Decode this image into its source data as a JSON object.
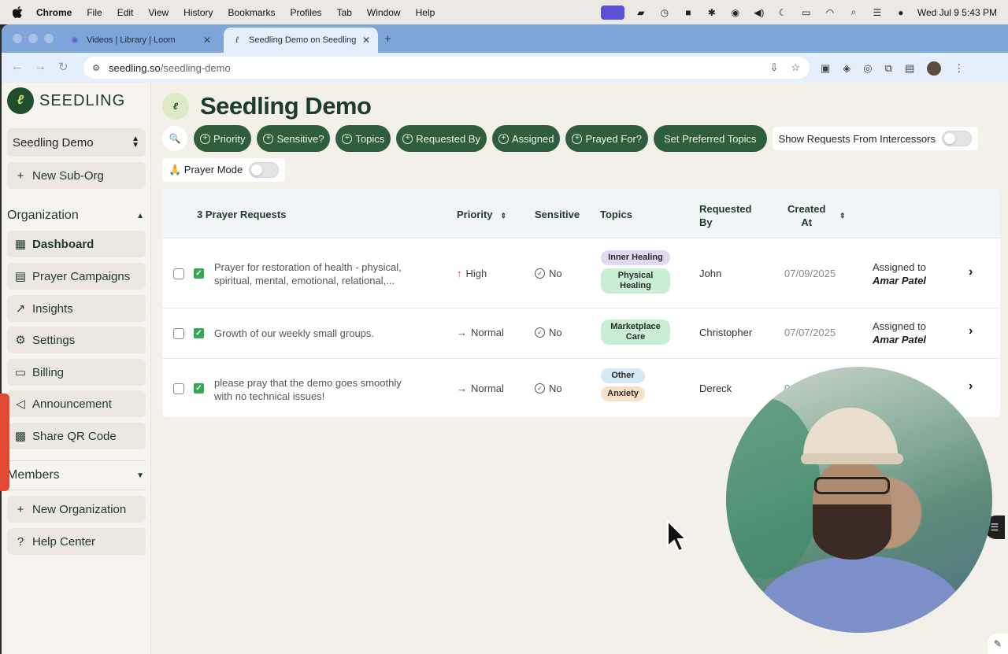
{
  "menubar": {
    "app": "Chrome",
    "items": [
      "File",
      "Edit",
      "View",
      "History",
      "Bookmarks",
      "Profiles",
      "Tab",
      "Window",
      "Help"
    ],
    "clock": "Wed Jul 9  5:43 PM"
  },
  "browser": {
    "tabs": [
      {
        "title": "Videos | Library | Loom",
        "icon": "loom-icon"
      },
      {
        "title": "Seedling Demo on Seedling",
        "icon": "seedling-icon"
      }
    ],
    "url_host": "seedling.so",
    "url_path": "/seedling-demo"
  },
  "sidebar": {
    "brand": "SEEDLING",
    "org_name": "Seedling Demo",
    "new_sub_org": "New Sub-Org",
    "organization_header": "Organization",
    "org_items": [
      {
        "label": "Dashboard",
        "icon": "dashboard-icon",
        "active": true
      },
      {
        "label": "Prayer Campaigns",
        "icon": "calendar-icon"
      },
      {
        "label": "Insights",
        "icon": "chart-icon"
      },
      {
        "label": "Settings",
        "icon": "gear-icon"
      },
      {
        "label": "Billing",
        "icon": "credit-card-icon"
      },
      {
        "label": "Announcement",
        "icon": "megaphone-icon"
      },
      {
        "label": "Share QR Code",
        "icon": "qr-code-icon"
      }
    ],
    "members_header": "Members",
    "new_organization": "New Organization",
    "help_center": "Help Center"
  },
  "main": {
    "title": "Seedling Demo",
    "filters": [
      "Priority",
      "Sensitive?",
      "Topics",
      "Requested By",
      "Assigned",
      "Prayed For?"
    ],
    "set_preferred_topics": "Set Preferred Topics",
    "show_intercessors": "Show Requests From Intercessors",
    "prayer_mode": "🙏 Prayer Mode",
    "table": {
      "count_header": "3 Prayer Requests",
      "headers": {
        "priority": "Priority",
        "sensitive": "Sensitive",
        "topics": "Topics",
        "requested_by_1": "Requested",
        "requested_by_2": "By",
        "created_1": "Created",
        "created_2": "At"
      },
      "rows": [
        {
          "text1": "Prayer for restoration of health - physical,",
          "text2": "spiritual, mental, emotional, relational,...",
          "priority": "High",
          "sensitive": "No",
          "topics": [
            "Inner Healing",
            "Physical Healing"
          ],
          "requested_by": "John",
          "created_at": "07/09/2025",
          "assigned_prefix": "Assigned to",
          "assigned_name": "Amar Patel"
        },
        {
          "text1": "Growth of our weekly small groups.",
          "text2": "",
          "priority": "Normal",
          "sensitive": "No",
          "topics": [
            "Marketplace Care"
          ],
          "requested_by": "Christopher",
          "created_at": "07/07/2025",
          "assigned_prefix": "Assigned to",
          "assigned_name": "Amar Patel"
        },
        {
          "text1": "please pray that the demo goes smoothly",
          "text2": "with no technical issues!",
          "priority": "Normal",
          "sensitive": "No",
          "topics": [
            "Other",
            "Anxiety"
          ],
          "requested_by": "Dereck",
          "created_at": "0",
          "assigned_prefix": "",
          "assigned_name": ""
        }
      ]
    }
  },
  "colors": {
    "primary_green": "#2f5e3c",
    "title_green": "#1c3e28",
    "page_bg": "#f3efe9",
    "tab_strip": "#7ea5d9"
  }
}
